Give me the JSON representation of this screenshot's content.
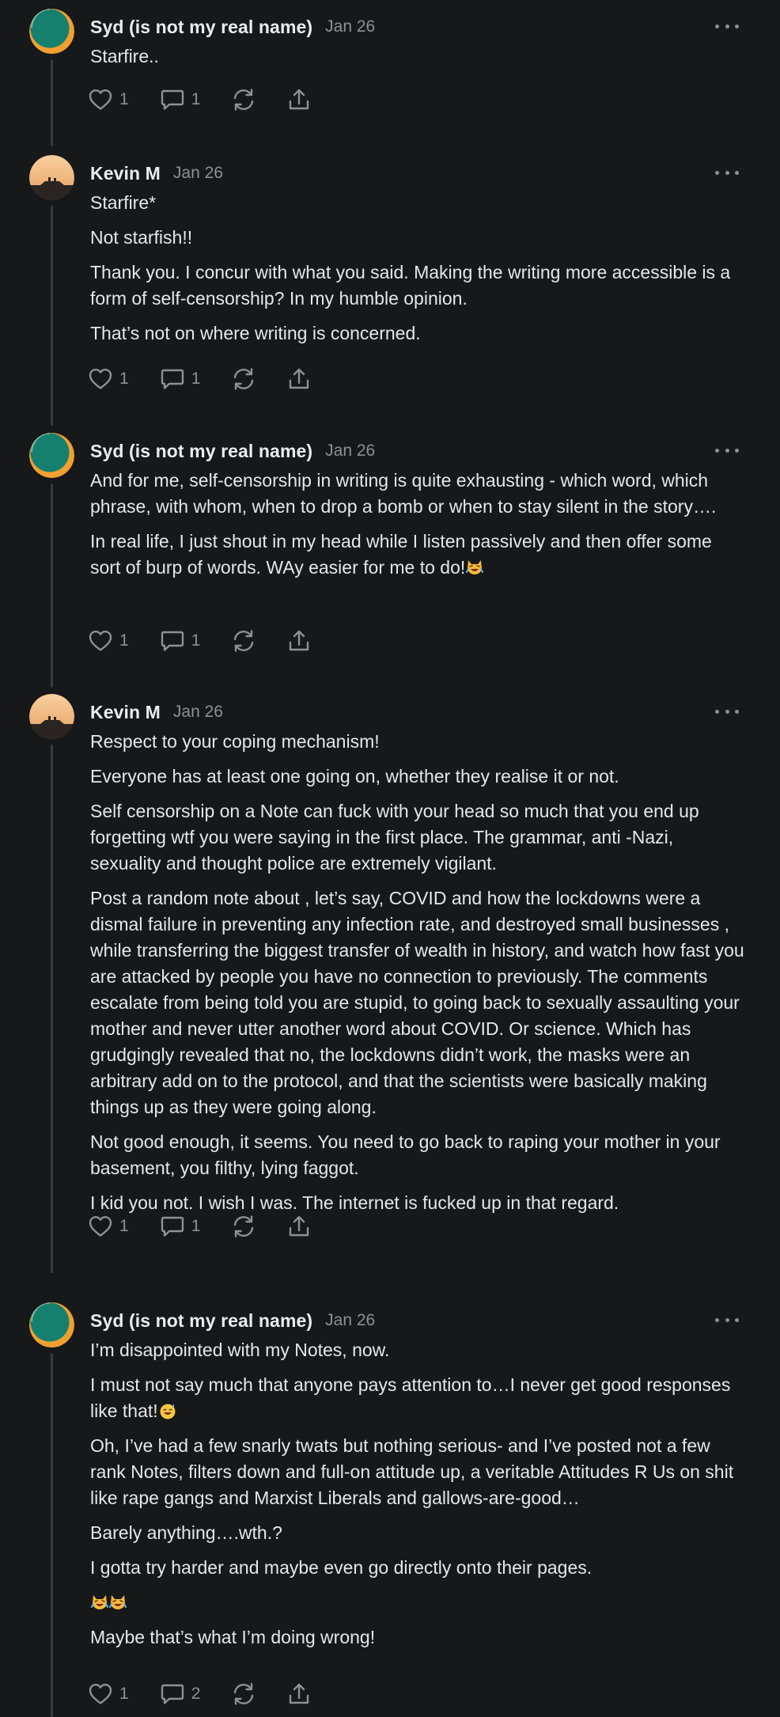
{
  "notes": [
    {
      "author": "Syd (is not my real name)",
      "date": "Jan 26",
      "avatar": "syd-avatar",
      "paragraphs": [
        "Starfire.."
      ],
      "likes": "1",
      "comments": "1"
    },
    {
      "author": "Kevin M",
      "date": "Jan 26",
      "avatar": "kevin-avatar",
      "paragraphs": [
        "Starfire*",
        "Not starfish!!",
        "Thank you. I concur with what you said. Making the writing more accessible is a form of self-censorship? In my humble opinion.",
        "That’s not on where writing is concerned."
      ],
      "likes": "1",
      "comments": "1"
    },
    {
      "author": "Syd (is not my real name)",
      "date": "Jan 26",
      "avatar": "syd-avatar",
      "paragraphs": [
        "And for me, self-censorship in writing is quite exhausting - which word, which phrase, with whom, when to drop a bomb or when to stay silent in the story….",
        "In real life, I just shout in my head while I listen passively and then offer some sort of burp of words. WAy easier for me to do!"
      ],
      "likes": "1",
      "comments": "1"
    },
    {
      "author": "Kevin M",
      "date": "Jan 26",
      "avatar": "kevin-avatar",
      "paragraphs": [
        "Respect to your coping mechanism!",
        "Everyone has at least one going on, whether they realise it or not.",
        "Self censorship on a Note can fuck with your head so much that you end up forgetting wtf you were saying in the first place. The grammar, anti -Nazi, sexuality and thought police are extremely vigilant.",
        "Post a random note about , let’s say, COVID and how the lockdowns were a dismal failure in preventing any infection rate, and destroyed small businesses , while transferring the biggest transfer of wealth in history, and watch how fast you are attacked by people you have no connection to previously. The comments escalate from being told you are stupid, to going back to sexually assaulting your mother and never utter another word about COVID. Or science. Which has grudgingly revealed that no, the lockdowns didn’t work, the masks were an arbitrary add on to the protocol, and that the scientists were basically making things up as they were going along.",
        "Not good enough, it seems. You need to go back to raping your mother in your basement, you filthy, lying faggot.",
        "I kid you not. I wish I was. The internet is fucked up in that regard."
      ],
      "likes": "1",
      "comments": "1"
    },
    {
      "author": "Syd (is not my real name)",
      "date": "Jan 26",
      "avatar": "syd-avatar",
      "paragraphs": [
        "I’m disappointed with my Notes, now.",
        "I must not say much that anyone pays attention to…I never get good responses like that!",
        "Oh, I’ve had a few snarly twats but nothing serious- and I’ve posted not a few rank Notes, filters down and full-on attitude up, a veritable Attitudes R Us on shit like rape gangs and Marxist Liberals and gallows-are-good…",
        "Barely anything….wth.?",
        "I gotta try harder and maybe even go directly onto their pages.",
        "",
        "Maybe that’s what I’m doing wrong!"
      ],
      "likes": "1",
      "comments": "2"
    }
  ],
  "icons": {
    "like": "heart-icon",
    "comment": "comment-icon",
    "restack": "restack-icon",
    "share": "share-icon",
    "more": "more-icon",
    "laugh": "laughing-cat-emoji",
    "sweat": "grinning-sweat-emoji"
  },
  "colors": {
    "background": "#17181a",
    "text": "#e6e7e9",
    "muted": "#8e9096",
    "rail": "#3a3b3f"
  }
}
